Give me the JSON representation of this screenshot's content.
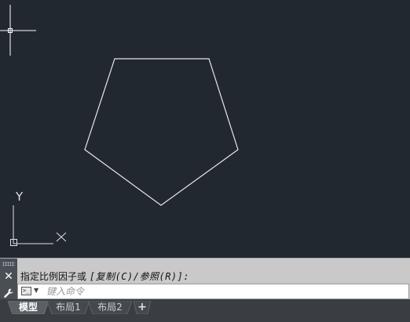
{
  "command_line": {
    "history_prefix": "指定比例因子或",
    "history_options": "[复制(C)/参照(R)]:",
    "input_placeholder": "键入命令",
    "input_value": ""
  },
  "axis_labels": {
    "y": "Y",
    "x": "X"
  },
  "tabs": [
    {
      "label": "模型",
      "active": true
    },
    {
      "label": "布局1",
      "active": false
    },
    {
      "label": "布局2",
      "active": false
    }
  ],
  "add_tab_symbol": "+",
  "icons": {
    "close": "close-icon",
    "settings": "wrench-icon",
    "prompt": "command-prompt-icon",
    "dropdown": "chevron-down-icon",
    "crosshair": "crosshair-cursor-icon",
    "ucs": "ucs-axis-icon"
  },
  "colors": {
    "canvas_bg": "#212830",
    "geometry": "#e8e8e8",
    "command_panel": "#c9c9c9",
    "tabbar": "#3a3d42"
  }
}
